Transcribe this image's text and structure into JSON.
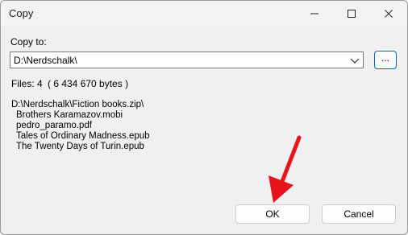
{
  "window": {
    "title": "Copy"
  },
  "form": {
    "copy_to_label": "Copy to:",
    "destination": "D:\\Nerdschalk\\",
    "browse_label": "..."
  },
  "summary": {
    "files_label": "Files: 4",
    "bytes_label": "( 6 434 670 bytes )"
  },
  "source": {
    "archive_path": "D:\\Nerdschalk\\Fiction books.zip\\",
    "files": [
      "Brothers Karamazov.mobi",
      "pedro_paramo.pdf",
      "Tales of Ordinary Madness.epub",
      "The Twenty Days of Turin.epub"
    ]
  },
  "buttons": {
    "ok": "OK",
    "cancel": "Cancel"
  },
  "icons": {
    "minimize": "minimize-icon",
    "maximize": "maximize-icon",
    "close": "close-icon",
    "dropdown": "chevron-down-icon",
    "annotation": "red-arrow-annotation"
  },
  "colors": {
    "accent": "#0a64c8",
    "annotation": "#e8141c"
  }
}
